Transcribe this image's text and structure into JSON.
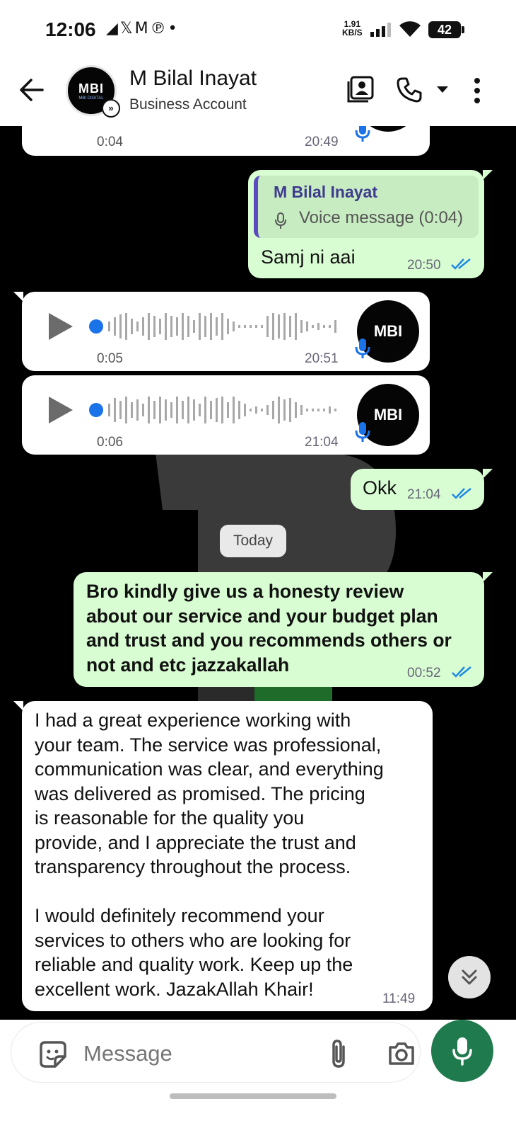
{
  "status_bar": {
    "time": "12:06",
    "notification_icons": "◢𝕏M℗•",
    "net_speed_top": "1.91",
    "net_speed_bottom": "KB/S",
    "battery": "42"
  },
  "header": {
    "contact_name": "M Bilal Inayat",
    "subtitle": "Business Account",
    "avatar_text": "MBI",
    "avatar_subtext": "MBI DIGITAL"
  },
  "messages": {
    "m0": {
      "duration": "0:04",
      "time": "20:49"
    },
    "m1": {
      "quote_name": "M Bilal Inayat",
      "quote_text": "Voice message (0:04)",
      "text": "Samj ni aai",
      "time": "20:50"
    },
    "m2": {
      "duration": "0:05",
      "time": "20:51"
    },
    "m3": {
      "duration": "0:06",
      "time": "21:04"
    },
    "m4": {
      "text": "Okk",
      "time": "21:04"
    },
    "date_divider": "Today",
    "m5": {
      "text": "Bro kindly give us a honesty review\nabout our service and your budget plan\nand trust and you recommends others or\nnot and etc jazzakallah",
      "time": "00:52"
    },
    "m6": {
      "text": "I had a great experience working with\nyour team. The service was professional,\ncommunication was clear, and everything\nwas delivered as promised. The pricing\nis reasonable for the quality you\nprovide, and I appreciate the trust and\ntransparency throughout the process.\n\nI would definitely recommend your\nservices to others who are looking for\nreliable and quality work. Keep up the\nexcellent work. JazakAllah Khair!",
      "time": "11:49"
    }
  },
  "input": {
    "placeholder": "Message"
  },
  "colors": {
    "outgoing_bubble": "#d9fdd3",
    "incoming_bubble": "#ffffff",
    "read_ticks": "#1e88e5",
    "mic_button": "#1f7a4d",
    "quote_bar": "#5b4bbf"
  },
  "icons": [
    "back-arrow-icon",
    "business-badge-icon",
    "contact-card-icon",
    "phone-icon",
    "dropdown-icon",
    "more-vert-icon",
    "play-icon",
    "mic-icon",
    "double-tick-icon",
    "chevron-double-down-icon",
    "sticker-icon",
    "attach-icon",
    "camera-icon"
  ]
}
